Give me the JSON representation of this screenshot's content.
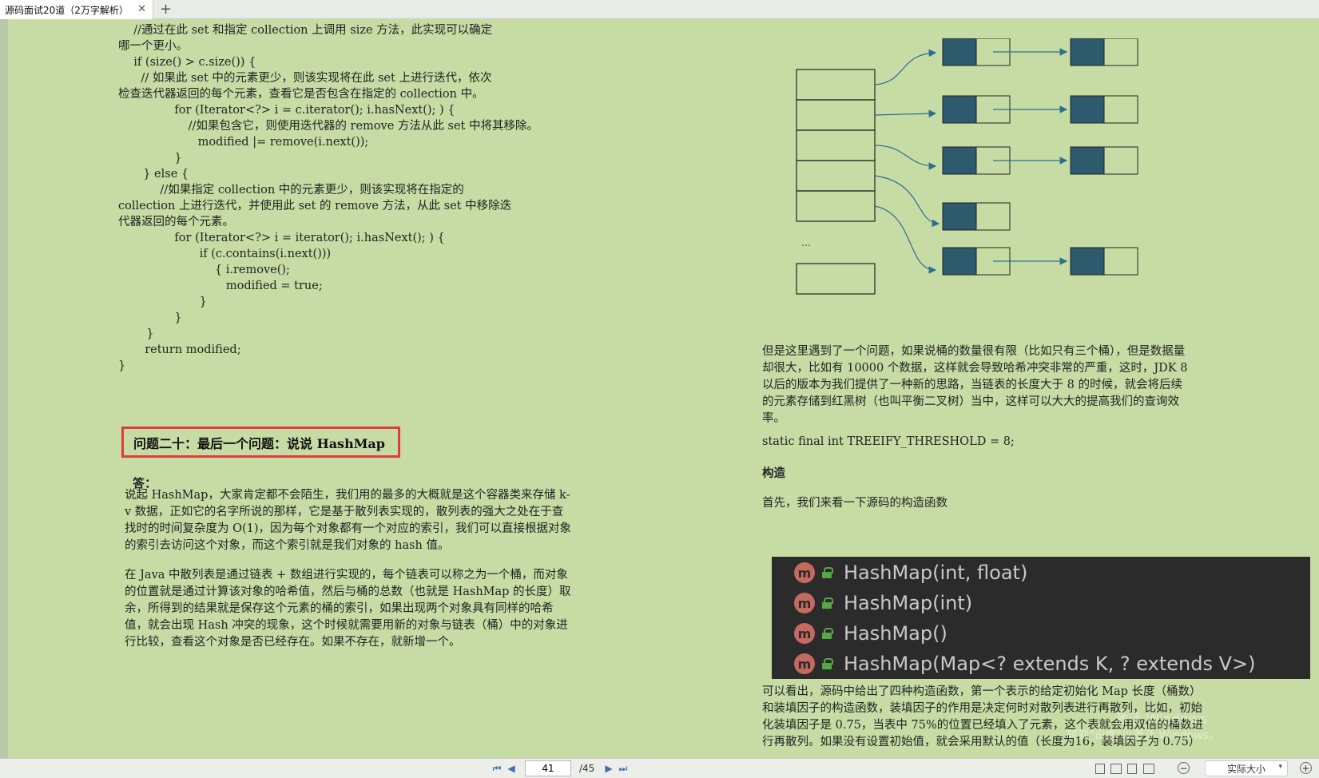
{
  "tab": {
    "title": "源码面试20道（2万字解析）",
    "close": "✕",
    "add": "+"
  },
  "code_left": [
    "  //通过在此 set 和指定 collection 上调用 size 方法，此实现可以确定",
    "哪一个更小。",
    "  if (size() > c.size()) {",
    "    // 如果此 set 中的元素更少，则该实现将在此 set 上进行迭代，依次",
    "检查迭代器返回的每个元素，查看它是否包含在指定的 collection 中。",
    "    for (Iterator<?> i = c.iterator(); i.hasNext(); ) {",
    "      //如果包含它，则使用迭代器的 remove 方法从此 set 中将其移除。",
    "      modified |= remove(i.next());",
    "    }",
    "  } else {",
    "    //如果指定 collection 中的元素更少，则该实现将在指定的",
    "collection 上进行迭代，并使用此 set 的 remove 方法，从此 set 中移除迭",
    "代器返回的每个元素。",
    "    for (Iterator<?> i = iterator(); i.hasNext(); ) {",
    "      if (c.contains(i.next()))",
    "        { i.remove();",
    "        modified = true;",
    "      }",
    "    }",
    "  }",
    "  return modified;",
    "}"
  ],
  "question_title": "问题二十：最后一个问题：说说 HashMap",
  "answer_label": "答：",
  "para1": "说起 HashMap，大家肯定都不会陌生，我们用的最多的大概就是这个容器类来存储 k-v 数据，正如它的名字所说的那样，它是基于散列表实现的，散列表的强大之处在于查找时的时间复杂度为 O(1)，因为每个对象都有一个对应的索引，我们可以直接根据对象的索引去访问这个对象，而这个索引就是我们对象的 hash 值。",
  "para2": "在 Java 中散列表是通过链表 + 数组进行实现的，每个链表可以称之为一个桶，而对象的位置就是通过计算该对象的哈希值，然后与桶的总数（也就是 HashMap 的长度）取余，所得到的结果就是保存这个元素的桶的索引，如果出现两个对象具有同样的哈希值，就会出现 Hash 冲突的现象，这个时候就需要用新的对象与链表（桶）中的对象进行比较，查看这个对象是否已经存在。如果不存在，就新增一个。",
  "diagram": {
    "ellipsis": "…"
  },
  "para3": "但是这里遇到了一个问题，如果说桶的数量很有限（比如只有三个桶），但是数据量却很大，比如有 10000 个数据，这样就会导致哈希冲突非常的严重，这时，JDK 8 以后的版本为我们提供了一种新的思路，当链表的长度大于 8 的时候，就会将后续的元素存储到红黑树（也叫平衡二叉树）当中，这样可以大大的提高我们的查询效率。",
  "code_treeify": "static final int TREEIFY_THRESHOLD = 8;",
  "section_title": "构造",
  "para4": "首先，我们来看一下源码的构造函数",
  "constructors": [
    "HashMap(int, float)",
    "HashMap(int)",
    "HashMap()",
    "HashMap(Map<? extends K, ? extends V>)"
  ],
  "ctor_icon_letter": "m",
  "para5": "可以看出，源码中给出了四种构造函数，第一个表示的给定初始化 Map 长度（桶数）和装填因子的构造函数，装填因子的作用是决定何时对散列表进行再散列，比如，初始化装填因子是 0.75，当表中 75%的位置已经填入了元素，这个表就会用双倍的桶数进行再散列。如果没有设置初始值，就会采用默认的值（长度为16，装填因子为 0.75）",
  "watermark": {
    "line1": "激活 Windows",
    "line2": "转到\"设置\"以激活 Windows。"
  },
  "bottombar": {
    "first": "⏮",
    "prev": "◀",
    "page_current": "41",
    "page_total": "/45",
    "next": "▶",
    "last": "⏭",
    "zoom_minus": "−",
    "zoom_label": "实际大小",
    "zoom_arrow": "▾",
    "zoom_plus": "+"
  },
  "colors": {
    "page_bg": "#c7dca4",
    "node_fill": "#2e5a6e",
    "arrow": "#2e6e8e",
    "highlight_border": "#e23b3b"
  }
}
